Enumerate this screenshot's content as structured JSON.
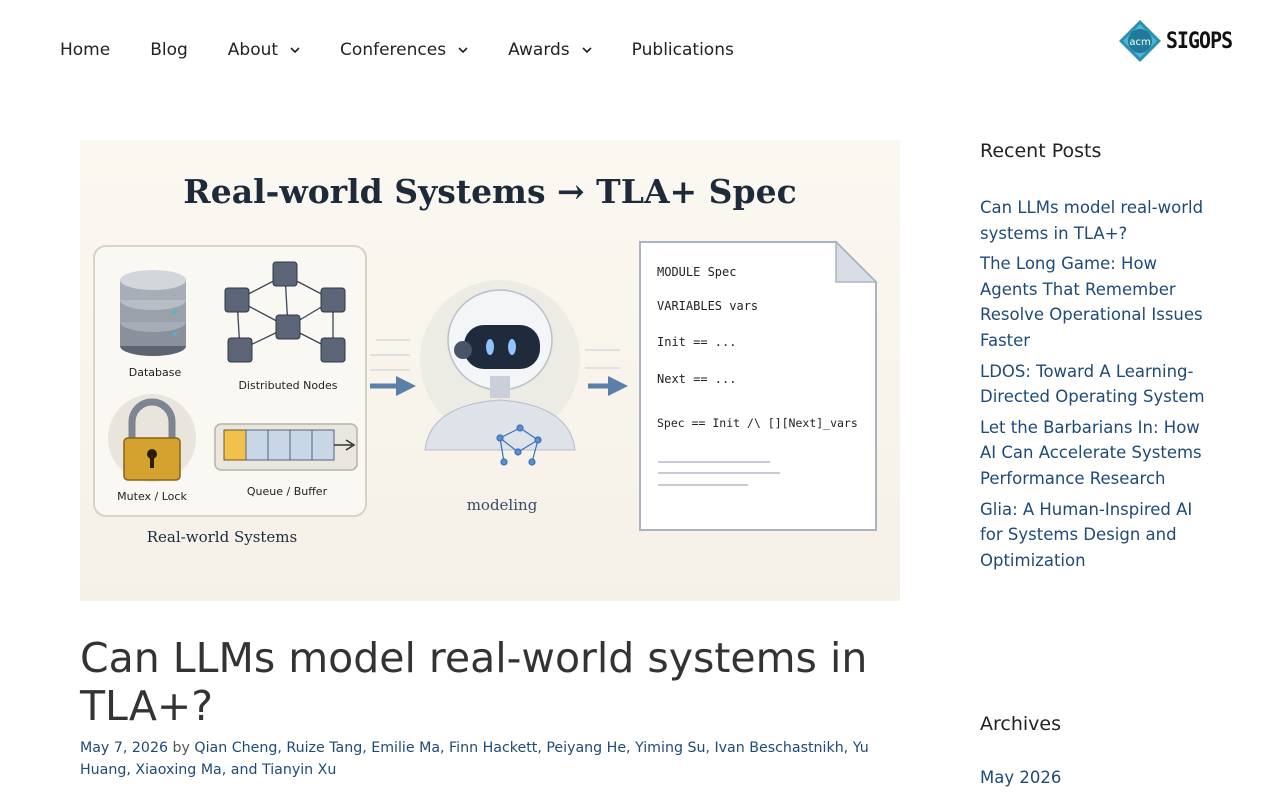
{
  "nav": {
    "items": [
      {
        "label": "Home",
        "dropdown": false
      },
      {
        "label": "Blog",
        "dropdown": false
      },
      {
        "label": "About",
        "dropdown": true
      },
      {
        "label": "Conferences",
        "dropdown": true
      },
      {
        "label": "Awards",
        "dropdown": true
      },
      {
        "label": "Publications",
        "dropdown": false
      }
    ]
  },
  "logo": {
    "badge": "acm",
    "text": "SIGOPS"
  },
  "hero": {
    "heading": "Real-world Systems → TLA+ Spec",
    "database_label": "Database",
    "nodes_label": "Distributed Nodes",
    "mutex_label": "Mutex / Lock",
    "queue_label": "Queue / Buffer",
    "panel_label": "Real-world Systems",
    "robot_label": "modeling",
    "spec_line_module": "MODULE Spec",
    "spec_line_variables": "VARIABLES vars",
    "spec_line_init": "Init == ...",
    "spec_line_next": "Next == ...",
    "spec_line_spec": "Spec == Init /\\ [][Next]_vars"
  },
  "post": {
    "title": "Can LLMs model real-world systems in TLA+?",
    "date": "May 7, 2026",
    "by": " by ",
    "authors_text": "Qian Cheng, Ruize Tang, Emilie Ma, Finn Hackett, Peiyang He, Yiming Su, Ivan Beschastnikh, Yu Huang, Xiaoxing Ma, and Tianyin Xu"
  },
  "sidebar": {
    "recent_title": "Recent Posts",
    "recent_posts": [
      "Can LLMs model real-world systems in TLA+?",
      "The Long Game: How Agents That Remember Resolve Operational Issues Faster",
      "LDOS: Toward A Learning-Directed Operating System",
      "Let the Barbarians In: How AI Can Accelerate Systems Performance Research",
      "Glia: A Human-Inspired AI for Systems Design and Optimization"
    ],
    "archives_title": "Archives",
    "archives": [
      "May 2026"
    ]
  },
  "colors": {
    "link": "#1e4a78",
    "text": "#222222",
    "accent_blue": "#3a5a80",
    "logo_teal": "#2a8fb0"
  }
}
